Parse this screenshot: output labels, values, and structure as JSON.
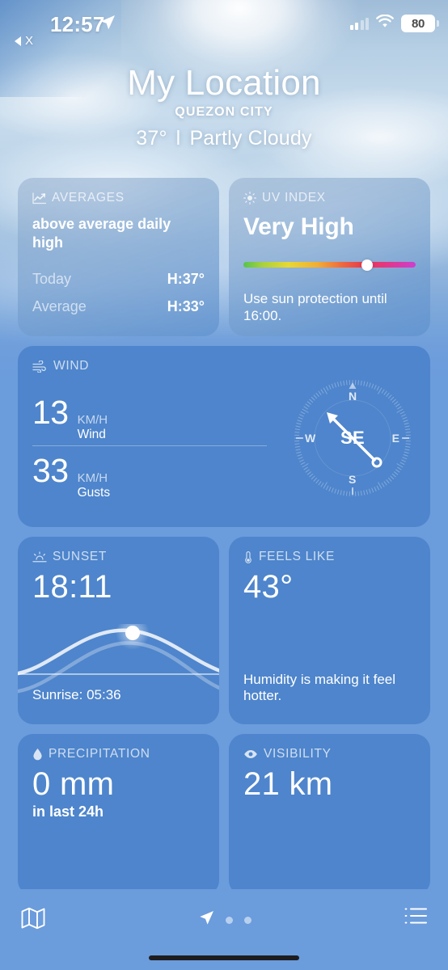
{
  "status_bar": {
    "time": "12:57",
    "location_arrow_icon": "location-arrow-icon",
    "back_to_app_label": "X",
    "signal_icon": "cellular-signal-icon",
    "wifi_icon": "wifi-icon",
    "battery_level": "80"
  },
  "header": {
    "title": "My Location",
    "subtitle": "QUEZON CITY",
    "temperature": "37°",
    "separator": "l",
    "condition": "Partly Cloudy"
  },
  "cards": {
    "averages": {
      "icon": "chart-line-icon",
      "title": "AVERAGES",
      "headline": "above average daily high",
      "rows": [
        {
          "label": "Today",
          "value": "H:37°"
        },
        {
          "label": "Average",
          "value": "H:33°"
        }
      ]
    },
    "uv_index": {
      "icon": "sun-icon",
      "title": "UV INDEX",
      "value": "Very High",
      "scale_position_pct": 72,
      "note": "Use sun protection until 16:00."
    },
    "wind": {
      "icon": "wind-icon",
      "title": "WIND",
      "wind_speed": "13",
      "wind_unit": "KM/H",
      "wind_label": "Wind",
      "gust_speed": "33",
      "gust_unit": "KM/H",
      "gust_label": "Gusts",
      "compass": {
        "direction": "SE",
        "north": "N",
        "east": "E",
        "south": "S",
        "west": "W",
        "needle_degrees": 135
      }
    },
    "sunset": {
      "icon": "sunset-icon",
      "title": "SUNSET",
      "value": "18:11",
      "footer": "Sunrise: 05:36",
      "sun_position_pct": 58
    },
    "feels_like": {
      "icon": "thermometer-icon",
      "title": "FEELS LIKE",
      "value": "43°",
      "note": "Humidity is making it feel hotter."
    },
    "precipitation": {
      "icon": "droplet-icon",
      "title": "PRECIPITATION",
      "value": "0 mm",
      "subtitle": "in last 24h"
    },
    "visibility": {
      "icon": "eye-icon",
      "title": "VISIBILITY",
      "value": "21 km"
    }
  },
  "toolbar": {
    "map_icon": "map-icon",
    "current_location_icon": "location-arrow-icon",
    "page_dots": 2,
    "list_icon": "list-icon"
  },
  "colors": {
    "background": "#6b9cdc",
    "card": "#4e85cc",
    "text": "#ffffff"
  }
}
